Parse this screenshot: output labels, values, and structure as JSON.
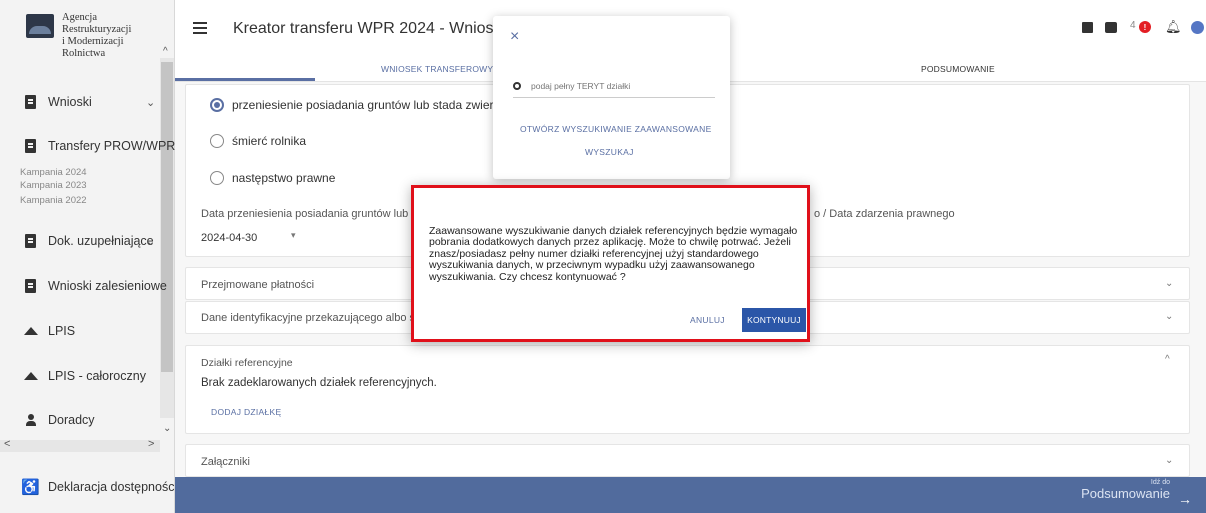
{
  "logo": {
    "line1": "Agencja Restrukturyzacji",
    "line2": "i Modernizacji Rolnictwa"
  },
  "sidebar": {
    "items": [
      {
        "label": "Wnioski"
      },
      {
        "label": "Transfery PROW/WPR"
      },
      {
        "label": "Dok. uzupełniające"
      },
      {
        "label": "Wnioski zalesieniowe"
      },
      {
        "label": "LPIS"
      },
      {
        "label": "LPIS - całoroczny"
      },
      {
        "label": "Doradcy"
      },
      {
        "label": "Deklaracja dostępności"
      }
    ],
    "campaigns": [
      "Kampania 2024",
      "Kampania 2023",
      "Kampania 2022"
    ]
  },
  "header": {
    "title": "Kreator transferu WPR 2024 - Wniosek trans",
    "notification_count": "4"
  },
  "tabs": [
    "WNIOSEK TRANSFEROWY",
    "PODSUMOWANIE"
  ],
  "form": {
    "radio_options": [
      "przeniesienie posiadania gruntów lub stada zwierząt ras",
      "śmierć rolnika",
      "następstwo prawne"
    ],
    "date_label": "Data przeniesienia posiadania gruntów lub s",
    "date_label_right": "o / Data zdarzenia prawnego",
    "date_value": "2024-04-30"
  },
  "sections": {
    "payments": "Przejmowane płatności",
    "identification": "Dane identyfikacyjne przekazującego albo spad",
    "plots_title": "Działki referencyjne",
    "plots_empty": "Brak zadeklarowanych działek referencyjnych.",
    "add_plot": "DODAJ DZIAŁKĘ",
    "attachments": "Załączniki"
  },
  "search_popup": {
    "placeholder": "podaj pełny TERYT działki",
    "advanced": "OTWÓRZ WYSZUKIWANIE ZAAWANSOWANE",
    "search": "WYSZUKAJ"
  },
  "dialog": {
    "message": "Zaawansowane wyszukiwanie danych działek referencyjnych będzie wymagało pobrania dodatkowych danych przez aplikację. Może to chwilę potrwać. Jeżeli znasz/posiadasz pełny numer działki referencyjnej użyj standardowego wyszukiwania danych, w przeciwnym wypadku użyj zaawansowanego wyszukiwania. Czy chcesz kontynuować ?",
    "cancel": "ANULUJ",
    "confirm": "KONTYNUUJ"
  },
  "footer": {
    "goto": "Idź do",
    "target": "Podsumowanie"
  },
  "colors": {
    "accent": "#5a6fa3",
    "footer": "#516b9d",
    "dialog_border": "#e0101a",
    "primary_button": "#2b56a8"
  }
}
